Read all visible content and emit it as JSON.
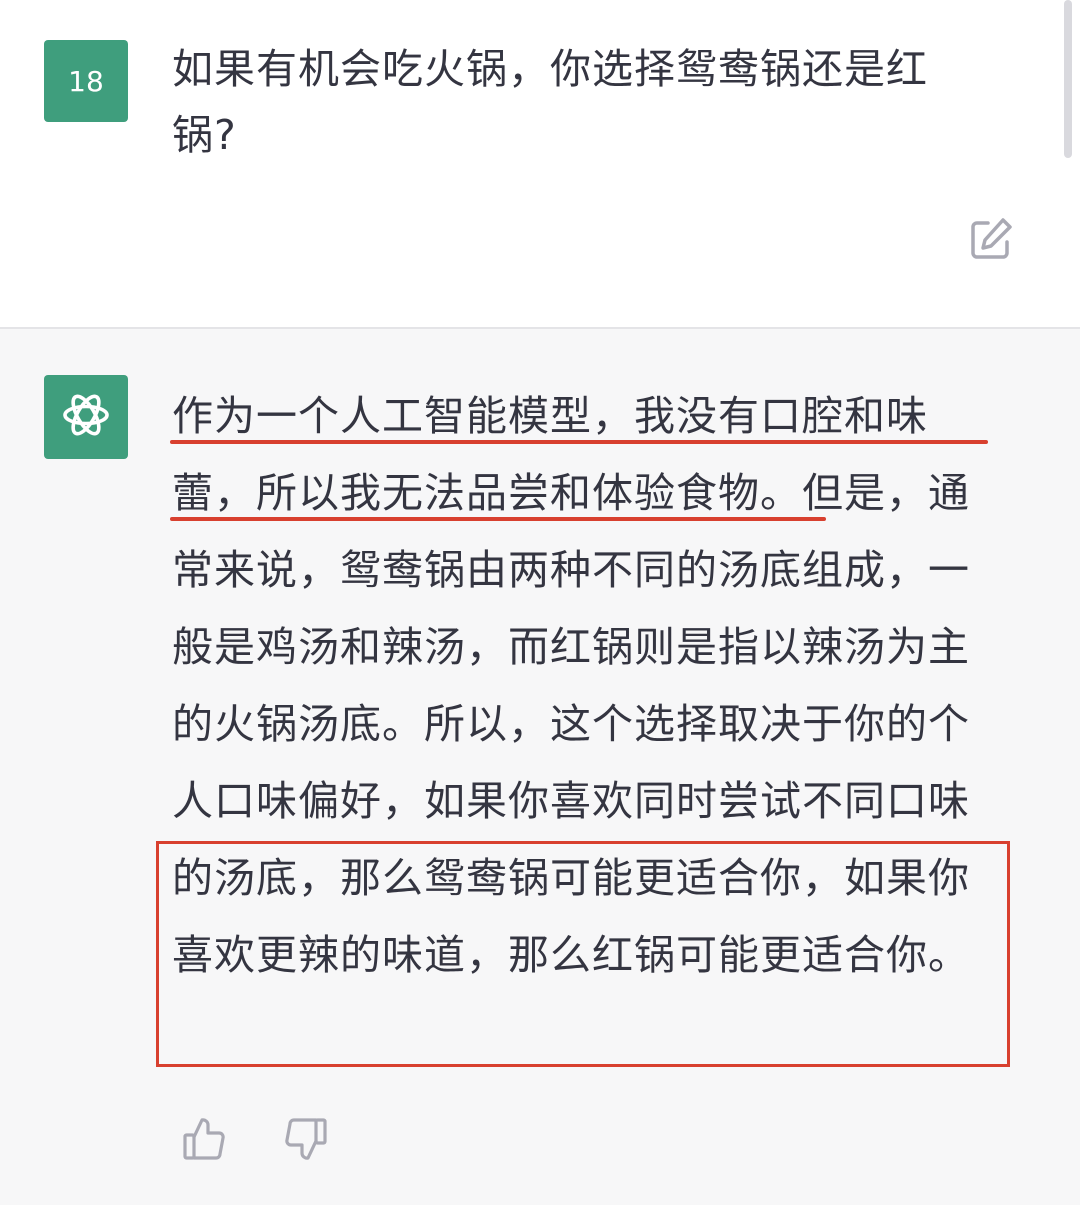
{
  "user_message": {
    "avatar_label": "18",
    "text": "如果有机会吃火锅，你选择鸳鸯锅还是红锅?"
  },
  "assistant_message": {
    "text": "作为一个人工智能模型，我没有口腔和味蕾，所以我无法品尝和体验食物。但是，通常来说，鸳鸯锅由两种不同的汤底组成，一般是鸡汤和辣汤，而红锅则是指以辣汤为主的火锅汤底。所以，这个选择取决于你的个人口味偏好，如果你喜欢同时尝试不同口味的汤底，那么鸳鸯锅可能更适合你，如果你喜欢更辣的味道，那么红锅可能更适合你。"
  },
  "icons": {
    "avatar_assistant": "openai-logo-icon",
    "edit": "edit-icon",
    "thumbs_up": "thumbs-up-icon",
    "thumbs_down": "thumbs-down-icon"
  },
  "colors": {
    "avatar_bg": "#3f9e7d",
    "annotation_red": "#d8402f",
    "assistant_bg": "#f7f7f8",
    "text": "#343541",
    "icon_gray": "#a9a9b3"
  }
}
